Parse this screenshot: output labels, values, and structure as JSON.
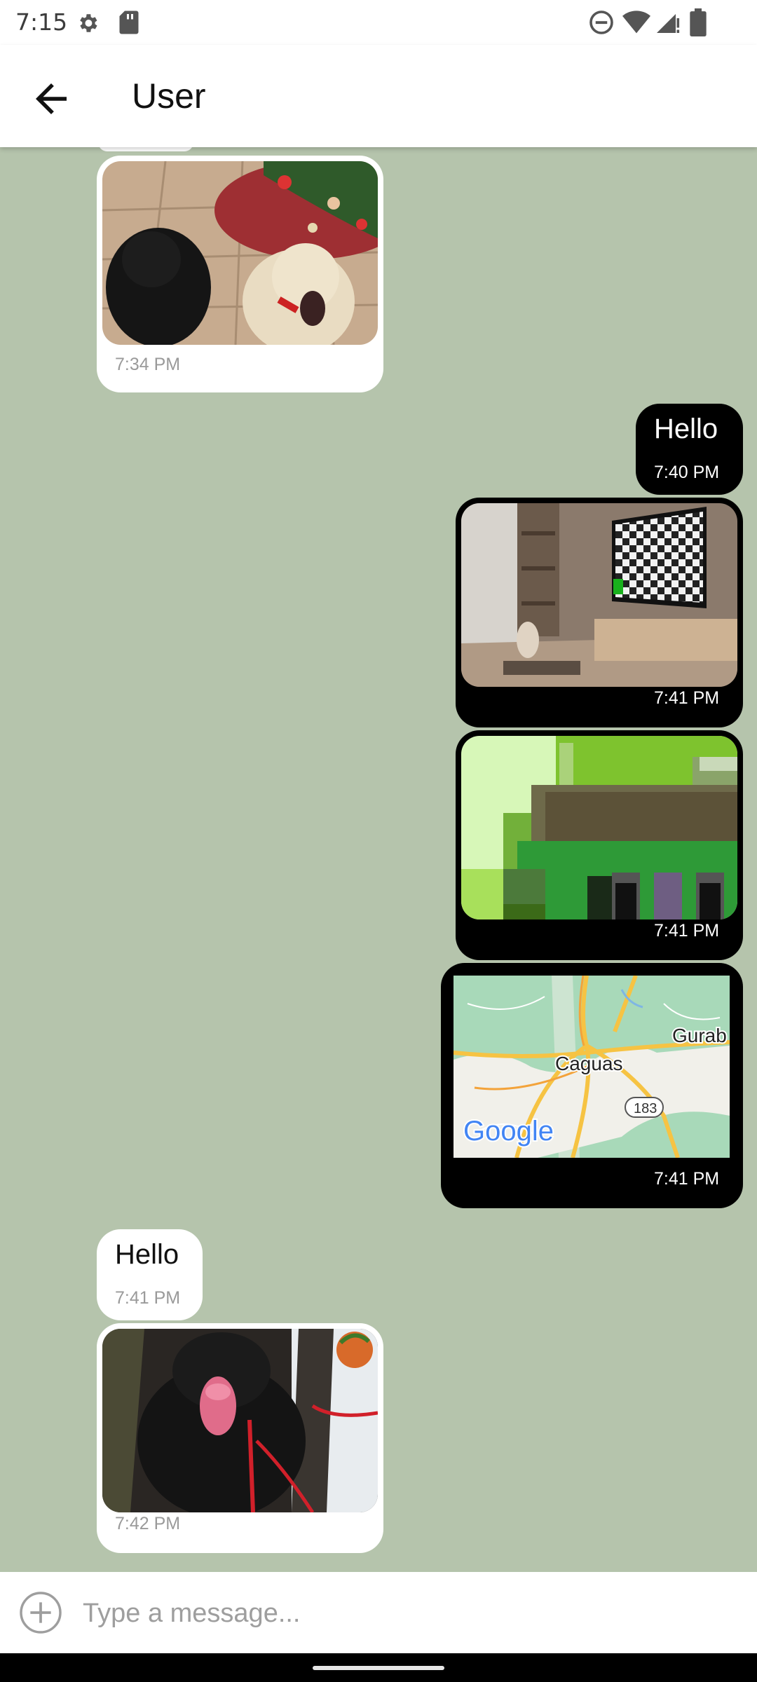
{
  "status_bar": {
    "time": "7:15",
    "icons": [
      "gear-icon",
      "sd-card-icon",
      "do-not-disturb-icon",
      "wifi-icon",
      "signal-icon",
      "battery-icon"
    ]
  },
  "app_bar": {
    "back_icon": "arrow-left-icon",
    "title": "User"
  },
  "messages": [
    {
      "direction": "incoming",
      "type": "image",
      "image": "dogs-christmas-tree",
      "time": "7:34 PM"
    },
    {
      "direction": "outgoing",
      "type": "text",
      "text": "Hello",
      "time": "7:40 PM"
    },
    {
      "direction": "outgoing",
      "type": "image",
      "image": "room-checkerboard-tv",
      "time": "7:41 PM"
    },
    {
      "direction": "outgoing",
      "type": "image",
      "image": "pixelated-green-image",
      "time": "7:41 PM"
    },
    {
      "direction": "outgoing",
      "type": "location",
      "map_labels": [
        "Caguas",
        "Gurab",
        "183"
      ],
      "map_logo": "Google",
      "time": "7:41 PM"
    },
    {
      "direction": "incoming",
      "type": "text",
      "text": "Hello",
      "time": "7:41 PM"
    },
    {
      "direction": "incoming",
      "type": "image",
      "image": "black-dog-tongue",
      "time": "7:42 PM"
    }
  ],
  "composer": {
    "add_icon": "plus-circle-icon",
    "placeholder": "Type a message..."
  },
  "colors": {
    "chat_background": "#b5c4ac",
    "incoming_bubble": "#ffffff",
    "outgoing_bubble": "#000000"
  }
}
